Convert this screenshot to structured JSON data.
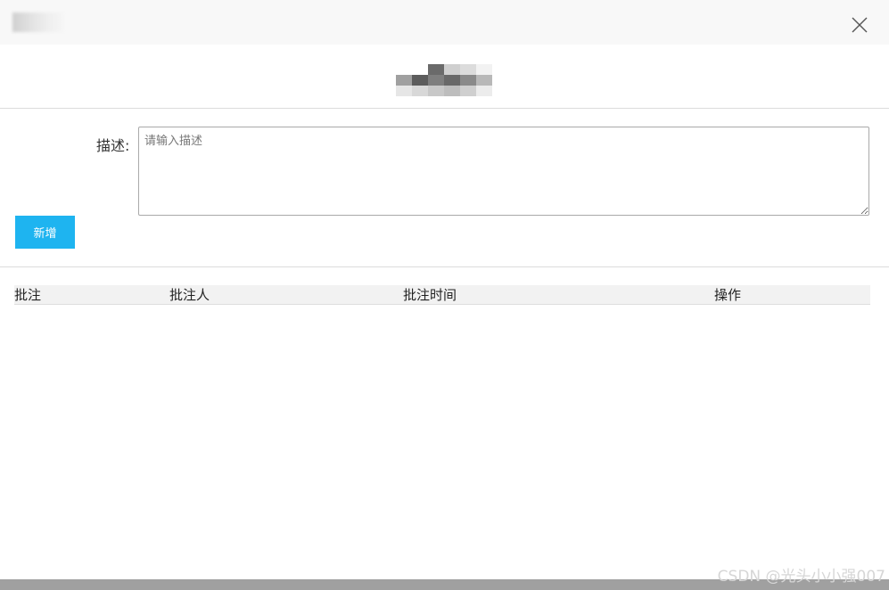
{
  "dialog": {
    "close_icon": "close-icon"
  },
  "form": {
    "desc_label": "描述:",
    "desc_placeholder": "请输入描述",
    "desc_value": "",
    "add_button_label": "新增"
  },
  "table": {
    "columns": [
      "批注",
      "批注人",
      "批注时间",
      "操作"
    ],
    "rows": []
  },
  "watermark": "CSDN @光头小小强007",
  "colors": {
    "accent": "#1eb4f0",
    "header_bg": "#f8f8f8",
    "table_head_bg": "#f2f2f2"
  }
}
